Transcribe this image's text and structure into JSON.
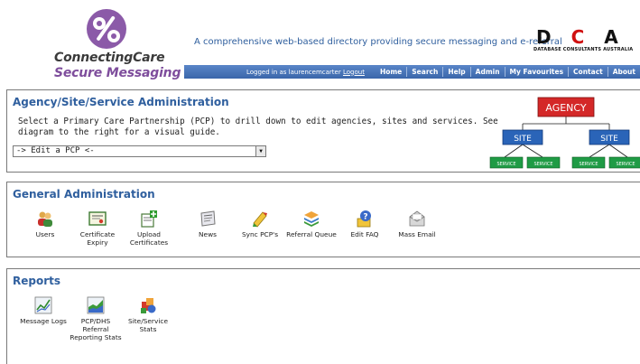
{
  "header": {
    "brand_line1": "ConnectingCare",
    "brand_line2": "Secure Messaging",
    "tagline": "A comprehensive web-based directory providing secure messaging and e-referral",
    "partner_logo": {
      "letters": [
        "D",
        "C",
        "A"
      ],
      "subtitle": "DATABASE CONSULTANTS AUSTRALIA"
    }
  },
  "navbar": {
    "login_prefix": "Logged in as laurencemcarter",
    "logout_label": "Logout",
    "links": [
      "Home",
      "Search",
      "Help",
      "Admin",
      "My Favourites",
      "Contact",
      "About"
    ]
  },
  "agency_panel": {
    "title": "Agency/Site/Service Administration",
    "description": "Select a Primary Care Partnership (PCP) to drill down to edit agencies, sites and services. See diagram to the right for a visual guide.",
    "select_value": "-> Edit a PCP <-",
    "diagram": {
      "top_label": "AGENCY",
      "mid_labels": [
        "SITE",
        "SITE"
      ],
      "leaf_labels": [
        "SERVICE",
        "SERVICE",
        "SERVICE",
        "SERVICE"
      ]
    }
  },
  "general_panel": {
    "title": "General Administration",
    "items": [
      {
        "label": "Users",
        "icon": "users-icon"
      },
      {
        "label": "Certificate Expiry",
        "icon": "certificate-icon"
      },
      {
        "label": "Upload Certificates",
        "icon": "upload-icon"
      },
      {
        "label": "News",
        "icon": "news-icon"
      },
      {
        "label": "Sync PCP's",
        "icon": "sync-icon"
      },
      {
        "label": "Referral Queue",
        "icon": "queue-icon"
      },
      {
        "label": "Edit FAQ",
        "icon": "faq-icon"
      },
      {
        "label": "Mass Email",
        "icon": "mail-icon"
      }
    ]
  },
  "reports_panel": {
    "title": "Reports",
    "items": [
      {
        "label": "Message Logs",
        "icon": "chart-line-icon"
      },
      {
        "label": "PCP/DHS Referral Reporting Stats",
        "icon": "chart-area-icon"
      },
      {
        "label": "Site/Service Stats",
        "icon": "stats-icon"
      }
    ]
  },
  "colors": {
    "accent_blue": "#2f5f9e",
    "nav_blue": "#3a66aa",
    "brand_purple": "#7e4d9c",
    "agency_red": "#d42828",
    "site_blue": "#2a64b8",
    "service_green": "#1f9b45"
  }
}
